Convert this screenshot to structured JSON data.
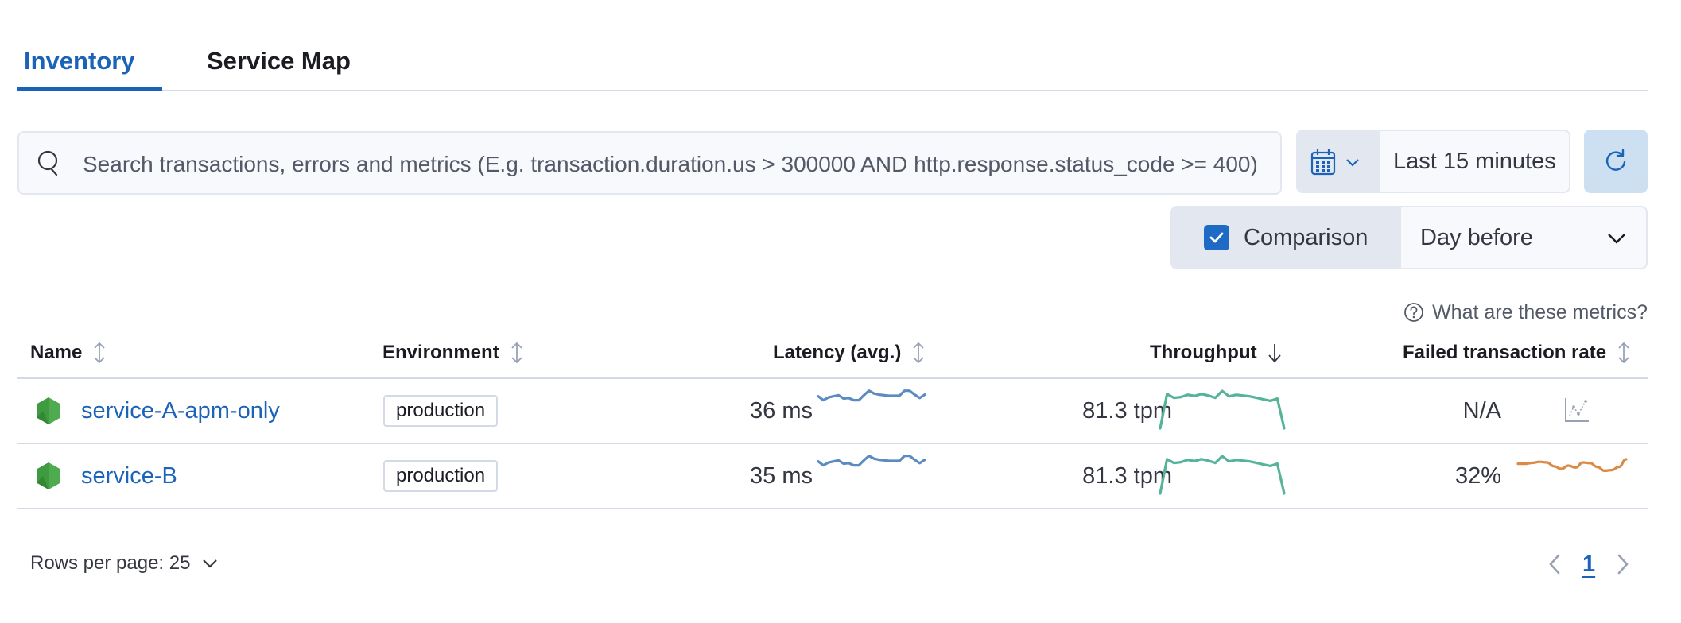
{
  "tabs": [
    {
      "label": "Inventory",
      "active": true
    },
    {
      "label": "Service Map",
      "active": false
    }
  ],
  "search": {
    "placeholder": "Search transactions, errors and metrics (E.g. transaction.duration.us > 300000 AND http.response.status_code >= 400)",
    "value": ""
  },
  "date_picker": {
    "quick_menu_icon": "calendar-icon",
    "value": "Last 15 minutes",
    "refresh_icon": "refresh-icon"
  },
  "comparison": {
    "label": "Comparison",
    "checked": true,
    "selected": "Day before"
  },
  "metrics_help": {
    "label": "What are these metrics?",
    "icon": "question-circle-icon"
  },
  "table": {
    "columns": [
      {
        "label": "Name",
        "sort": "none"
      },
      {
        "label": "Environment",
        "sort": "none"
      },
      {
        "label": "Latency (avg.)",
        "sort": "none"
      },
      {
        "label": "Throughput",
        "sort": "desc"
      },
      {
        "label": "Failed transaction rate",
        "sort": "none"
      }
    ],
    "rows": [
      {
        "name": "service-A-apm-only",
        "agent_icon": "nodejs-icon",
        "environment": "production",
        "latency": "36 ms",
        "throughput": "81.3 tpm",
        "failed_rate": "N/A",
        "failed_rate_spark": null,
        "latency_spark": [
          0.45,
          0.1,
          0.35,
          0.45,
          0.55,
          0.25,
          0.3,
          0.1,
          0.1,
          0.55,
          0.95,
          0.7,
          0.6,
          0.55,
          0.5,
          0.5,
          0.5,
          0.95,
          0.95,
          0.6,
          0.3,
          0.6
        ],
        "throughput_spark": [
          0.0,
          0.9,
          0.8,
          0.82,
          0.88,
          0.85,
          0.9,
          0.86,
          0.8,
          0.98,
          0.84,
          0.88,
          0.86,
          0.84,
          0.8,
          0.76,
          0.72,
          0.78,
          0.0
        ]
      },
      {
        "name": "service-B",
        "agent_icon": "nodejs-icon",
        "environment": "production",
        "latency": "35 ms",
        "throughput": "81.3 tpm",
        "failed_rate": "32%",
        "failed_rate_spark": [
          0.65,
          0.65,
          0.72,
          0.8,
          0.75,
          0.45,
          0.25,
          0.5,
          0.35,
          0.75,
          0.7,
          0.4,
          0.1,
          0.15,
          0.4,
          1.0
        ],
        "latency_spark": [
          0.45,
          0.1,
          0.35,
          0.45,
          0.55,
          0.25,
          0.3,
          0.1,
          0.1,
          0.55,
          0.95,
          0.7,
          0.6,
          0.55,
          0.5,
          0.5,
          0.5,
          0.95,
          0.95,
          0.6,
          0.3,
          0.6
        ],
        "throughput_spark": [
          0.0,
          0.9,
          0.8,
          0.82,
          0.88,
          0.85,
          0.9,
          0.86,
          0.8,
          0.98,
          0.84,
          0.88,
          0.86,
          0.84,
          0.8,
          0.76,
          0.72,
          0.78,
          0.0
        ]
      }
    ]
  },
  "pagination": {
    "rows_per_page_label": "Rows per page: 25",
    "current_page": "1"
  },
  "colors": {
    "accent": "#1a63b8",
    "latency_line": "#5b8bc0",
    "throughput_line": "#54b399",
    "failed_rate_line": "#da8b45",
    "nodejs_green": "#3f9b3f"
  }
}
